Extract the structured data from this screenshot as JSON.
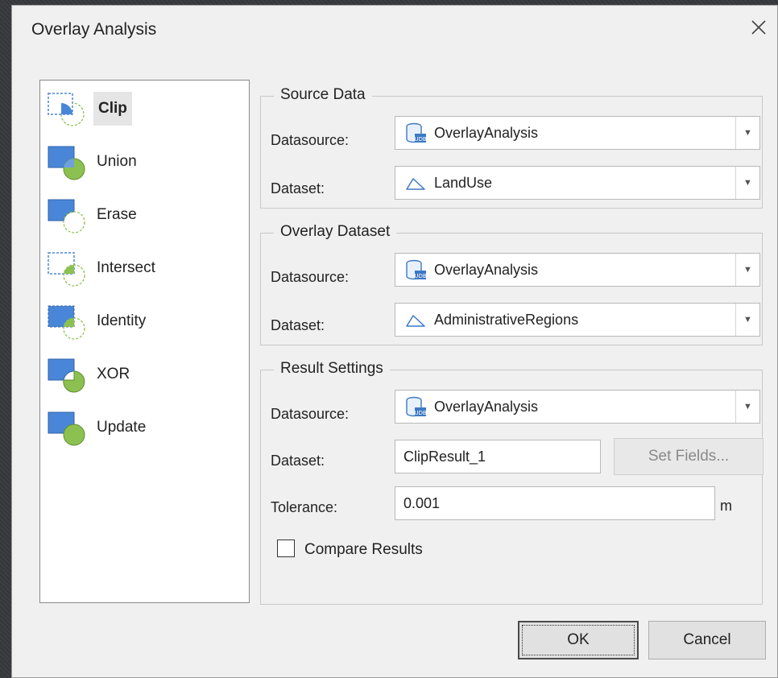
{
  "window": {
    "title": "Overlay Analysis"
  },
  "tools": [
    {
      "label": "Clip",
      "icon": "clip-icon",
      "selected": true
    },
    {
      "label": "Union",
      "icon": "union-icon"
    },
    {
      "label": "Erase",
      "icon": "erase-icon"
    },
    {
      "label": "Intersect",
      "icon": "intersect-icon"
    },
    {
      "label": "Identity",
      "icon": "identity-icon"
    },
    {
      "label": "XOR",
      "icon": "xor-icon"
    },
    {
      "label": "Update",
      "icon": "update-icon"
    }
  ],
  "source": {
    "legend": "Source Data",
    "datasource_label": "Datasource:",
    "datasource_value": "OverlayAnalysis",
    "dataset_label": "Dataset:",
    "dataset_value": "LandUse"
  },
  "overlay": {
    "legend": "Overlay Dataset",
    "datasource_label": "Datasource:",
    "datasource_value": "OverlayAnalysis",
    "dataset_label": "Dataset:",
    "dataset_value": "AdministrativeRegions"
  },
  "result": {
    "legend": "Result Settings",
    "datasource_label": "Datasource:",
    "datasource_value": "OverlayAnalysis",
    "dataset_label": "Dataset:",
    "dataset_value": "ClipResult_1",
    "set_fields_label": "Set Fields...",
    "tolerance_label": "Tolerance:",
    "tolerance_value": "0.001",
    "tolerance_unit": "m",
    "compare_label": "Compare Results",
    "compare_checked": false
  },
  "buttons": {
    "ok": "OK",
    "cancel": "Cancel"
  },
  "colors": {
    "accent_blue": "#4a86d8",
    "accent_green": "#8cc152",
    "dialog_bg": "#f0f0f0"
  }
}
